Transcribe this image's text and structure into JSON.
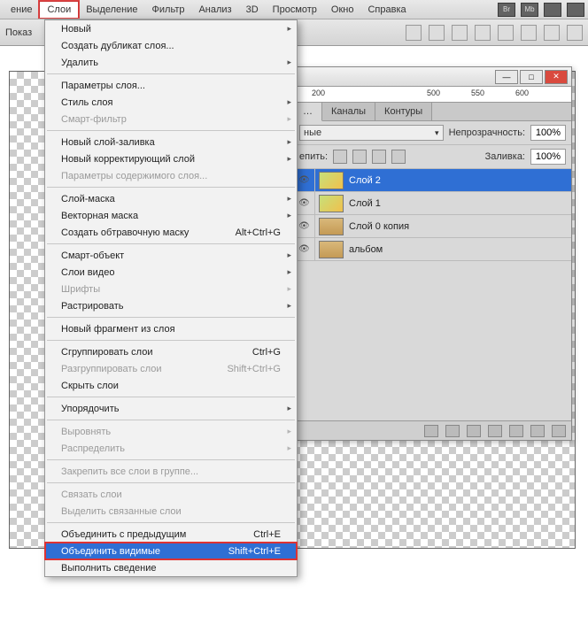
{
  "menubar": {
    "items": [
      "ение",
      "Слои",
      "Выделение",
      "Фильтр",
      "Анализ",
      "3D",
      "Просмотр",
      "Окно",
      "Справка"
    ],
    "active_index": 1,
    "right_icons": [
      "Br",
      "Mb",
      "film",
      "grid"
    ]
  },
  "options_bar": {
    "label": "Показ"
  },
  "ruler": {
    "ticks": [
      "200",
      "500",
      "550",
      "600"
    ]
  },
  "panel": {
    "tabs": [
      "…",
      "Каналы",
      "Контуры"
    ],
    "blend_mode": "ные",
    "opacity_label": "Непрозрачность:",
    "opacity_value": "100%",
    "lock_label": "епить:",
    "fill_label": "Заливка:",
    "fill_value": "100%",
    "layers": [
      {
        "name": "Слой 2",
        "selected": true,
        "thumb": "img"
      },
      {
        "name": "Слой 1",
        "selected": false,
        "thumb": "img"
      },
      {
        "name": "Слой 0 копия",
        "selected": false,
        "thumb": "book"
      },
      {
        "name": "альбом",
        "selected": false,
        "thumb": "book"
      }
    ],
    "footer_icons": [
      "link",
      "fx",
      "mask",
      "adjust",
      "group",
      "new",
      "trash"
    ]
  },
  "menu": [
    {
      "t": "item",
      "label": "Новый",
      "sub": true
    },
    {
      "t": "item",
      "label": "Создать дубликат слоя..."
    },
    {
      "t": "item",
      "label": "Удалить",
      "sub": true
    },
    {
      "t": "sep"
    },
    {
      "t": "item",
      "label": "Параметры слоя..."
    },
    {
      "t": "item",
      "label": "Стиль слоя",
      "sub": true
    },
    {
      "t": "item",
      "label": "Смарт-фильтр",
      "disabled": true,
      "sub": true
    },
    {
      "t": "sep"
    },
    {
      "t": "item",
      "label": "Новый слой-заливка",
      "sub": true
    },
    {
      "t": "item",
      "label": "Новый корректирующий слой",
      "sub": true
    },
    {
      "t": "item",
      "label": "Параметры содержимого слоя...",
      "disabled": true
    },
    {
      "t": "sep"
    },
    {
      "t": "item",
      "label": "Слой-маска",
      "sub": true
    },
    {
      "t": "item",
      "label": "Векторная маска",
      "sub": true
    },
    {
      "t": "item",
      "label": "Создать обтравочную маску",
      "shortcut": "Alt+Ctrl+G"
    },
    {
      "t": "sep"
    },
    {
      "t": "item",
      "label": "Смарт-объект",
      "sub": true
    },
    {
      "t": "item",
      "label": "Слои видео",
      "sub": true
    },
    {
      "t": "item",
      "label": "Шрифты",
      "disabled": true,
      "sub": true
    },
    {
      "t": "item",
      "label": "Растрировать",
      "sub": true
    },
    {
      "t": "sep"
    },
    {
      "t": "item",
      "label": "Новый фрагмент из слоя"
    },
    {
      "t": "sep"
    },
    {
      "t": "item",
      "label": "Сгруппировать слои",
      "shortcut": "Ctrl+G"
    },
    {
      "t": "item",
      "label": "Разгруппировать слои",
      "shortcut": "Shift+Ctrl+G",
      "disabled": true
    },
    {
      "t": "item",
      "label": "Скрыть слои"
    },
    {
      "t": "sep"
    },
    {
      "t": "item",
      "label": "Упорядочить",
      "sub": true
    },
    {
      "t": "sep"
    },
    {
      "t": "item",
      "label": "Выровнять",
      "disabled": true,
      "sub": true
    },
    {
      "t": "item",
      "label": "Распределить",
      "disabled": true,
      "sub": true
    },
    {
      "t": "sep"
    },
    {
      "t": "item",
      "label": "Закрепить все слои в группе...",
      "disabled": true
    },
    {
      "t": "sep"
    },
    {
      "t": "item",
      "label": "Связать слои",
      "disabled": true
    },
    {
      "t": "item",
      "label": "Выделить связанные слои",
      "disabled": true
    },
    {
      "t": "sep"
    },
    {
      "t": "item",
      "label": "Объединить с предыдущим",
      "shortcut": "Ctrl+E"
    },
    {
      "t": "item",
      "label": "Объединить видимые",
      "shortcut": "Shift+Ctrl+E",
      "hl": true,
      "boxed": true
    },
    {
      "t": "item",
      "label": "Выполнить сведение"
    }
  ]
}
